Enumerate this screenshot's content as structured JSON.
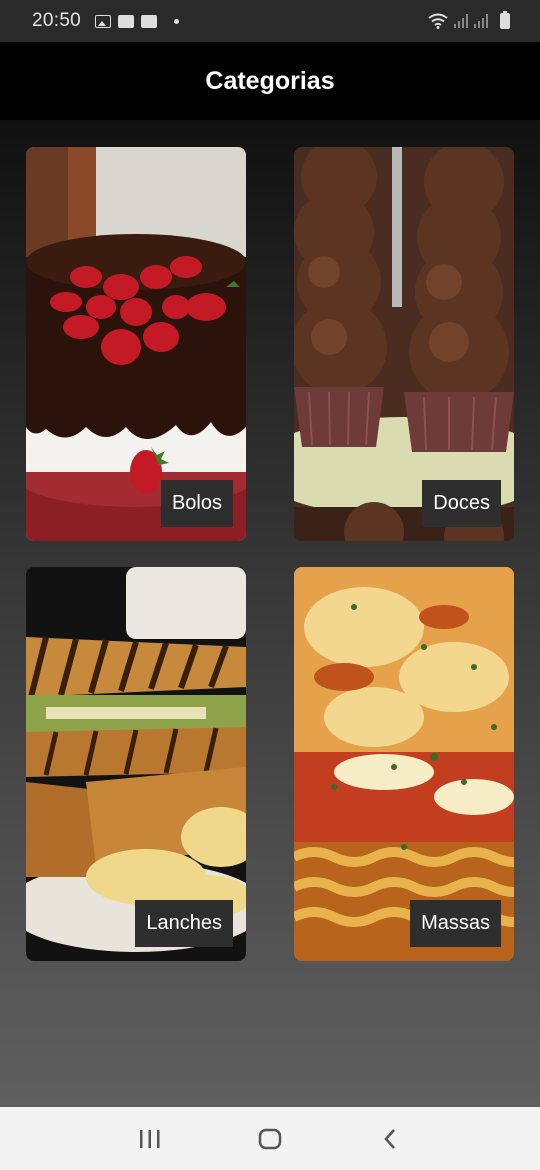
{
  "status_bar": {
    "time": "20:50",
    "left_icons": [
      "image-icon",
      "voicemail-icon",
      "voicemail-icon",
      "dot-icon"
    ],
    "right_icons": [
      "wifi-icon",
      "signal-icon",
      "signal-icon",
      "battery-icon"
    ]
  },
  "app_bar": {
    "title": "Categorias"
  },
  "categories": [
    {
      "label": "Bolos",
      "image": "chocolate cake with strawberries"
    },
    {
      "label": "Doces",
      "image": "brigadeiros"
    },
    {
      "label": "Lanches",
      "image": "grilled sandwich with chips"
    },
    {
      "label": "Massas",
      "image": "lasagna"
    }
  ],
  "nav_bar": {
    "buttons": [
      "recent-apps-icon",
      "home-icon",
      "back-icon"
    ]
  },
  "colors": {
    "background": "#000000",
    "label_bg": "#2e2e2e",
    "nav_bg": "#f3f3f3"
  }
}
